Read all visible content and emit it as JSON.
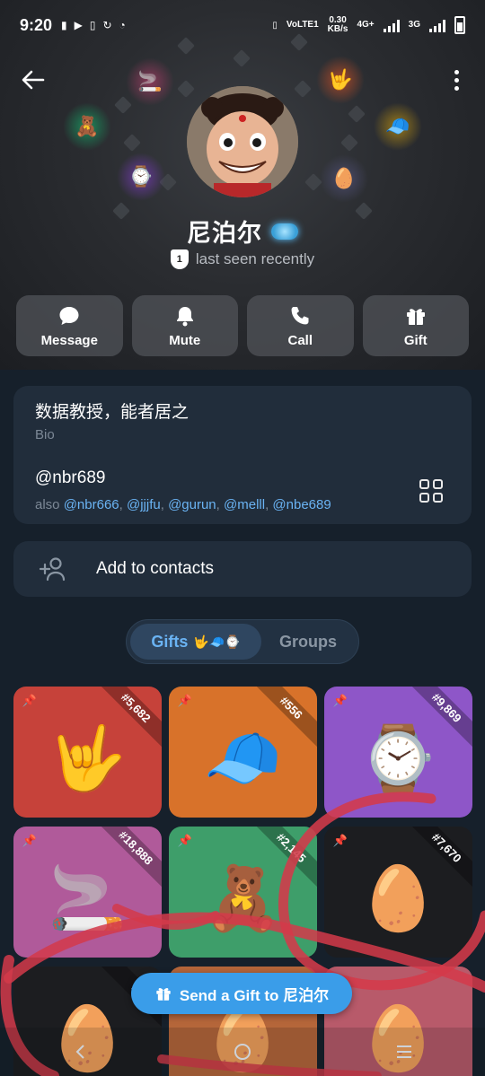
{
  "status_bar": {
    "time": "9:20",
    "left_icons": [
      "signal-indicator",
      "youtube-icon",
      "battery-saver-icon",
      "sync-icon",
      "vpn-icon"
    ],
    "net_speed": "0.30",
    "net_unit": "KB/s",
    "network_1": "4G+",
    "network_2": "3G",
    "lte": "VoLTE1"
  },
  "profile": {
    "name": "尼泊尔",
    "last_seen": "last seen recently",
    "shield_label": "1"
  },
  "actions": [
    {
      "label": "Message",
      "icon": "chat-bubble-icon"
    },
    {
      "label": "Mute",
      "icon": "bell-icon"
    },
    {
      "label": "Call",
      "icon": "phone-icon"
    },
    {
      "label": "Gift",
      "icon": "gift-icon"
    }
  ],
  "info": {
    "bio": "数据教授，能者居之",
    "bio_label": "Bio",
    "username": "@nbr689",
    "also_prefix": "also",
    "also_links": [
      "@nbr666",
      "@jjjfu",
      "@gurun",
      "@melll",
      "@nbe689"
    ]
  },
  "add_contact": {
    "label": "Add to contacts"
  },
  "tabs": {
    "gifts": "Gifts",
    "groups": "Groups",
    "active": "gifts"
  },
  "gifts": [
    {
      "number": "#5,682",
      "name": "gesture-hand-gift",
      "bg": "#c6423a"
    },
    {
      "number": "#556",
      "name": "green-cap-gift",
      "bg": "#d8722a"
    },
    {
      "number": "#9,869",
      "name": "gold-watch-gift",
      "bg": "#8e56c8"
    },
    {
      "number": "#18,888",
      "name": "cigar-gift",
      "bg": "#b05a9a"
    },
    {
      "number": "#2,145",
      "name": "teddy-bear-gift",
      "bg": "#3e9e6a"
    },
    {
      "number": "#7,670",
      "name": "easter-egg-gift",
      "bg": "#1c1d20"
    },
    {
      "number": "#",
      "name": "easter-egg-gift",
      "bg": "#1c1d20"
    },
    {
      "number": "",
      "name": "easter-egg-gift",
      "bg": "#b5663a"
    },
    {
      "number": "",
      "name": "easter-egg-gift",
      "bg": "#b85a6a"
    }
  ],
  "send_gift": {
    "label": "Send a Gift to 尼泊尔"
  },
  "colors": {
    "accent": "#3a9de9",
    "link": "#6ab3f3",
    "card": "#212d3b",
    "bg": "#16202b"
  }
}
